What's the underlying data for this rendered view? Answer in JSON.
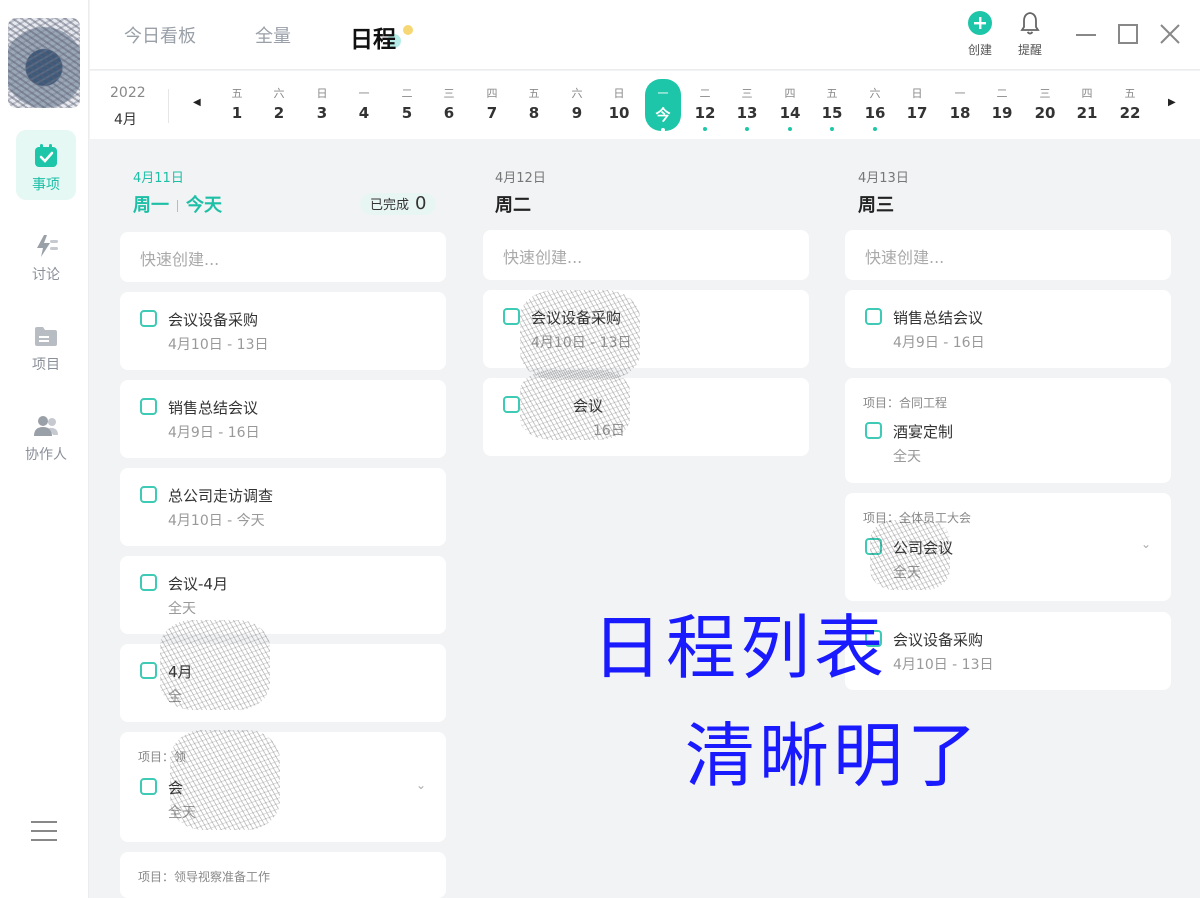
{
  "sidebar": {
    "items": [
      {
        "label": "事项",
        "icon": "calendar-check-icon"
      },
      {
        "label": "讨论",
        "icon": "lightning-icon"
      },
      {
        "label": "项目",
        "icon": "folder-icon"
      },
      {
        "label": "协作人",
        "icon": "people-icon"
      }
    ],
    "menu_icon": "hamburger-menu-icon"
  },
  "header": {
    "tabs": [
      {
        "label": "今日看板"
      },
      {
        "label": "全量"
      },
      {
        "label": "日程"
      }
    ],
    "actions": [
      {
        "label": "创建",
        "icon": "plus-circle-icon"
      },
      {
        "label": "提醒",
        "icon": "bell-icon"
      }
    ]
  },
  "datestrip": {
    "year": "2022",
    "month": "4月",
    "days": [
      {
        "wd": "五",
        "dn": "1"
      },
      {
        "wd": "六",
        "dn": "2"
      },
      {
        "wd": "日",
        "dn": "3"
      },
      {
        "wd": "一",
        "dn": "4"
      },
      {
        "wd": "二",
        "dn": "5"
      },
      {
        "wd": "三",
        "dn": "6"
      },
      {
        "wd": "四",
        "dn": "7"
      },
      {
        "wd": "五",
        "dn": "8"
      },
      {
        "wd": "六",
        "dn": "9"
      },
      {
        "wd": "日",
        "dn": "10"
      },
      {
        "wd": "一",
        "dn": "今"
      },
      {
        "wd": "二",
        "dn": "12"
      },
      {
        "wd": "三",
        "dn": "13"
      },
      {
        "wd": "四",
        "dn": "14"
      },
      {
        "wd": "五",
        "dn": "15"
      },
      {
        "wd": "六",
        "dn": "16"
      },
      {
        "wd": "日",
        "dn": "17"
      },
      {
        "wd": "一",
        "dn": "18"
      },
      {
        "wd": "二",
        "dn": "19"
      },
      {
        "wd": "三",
        "dn": "20"
      },
      {
        "wd": "四",
        "dn": "21"
      },
      {
        "wd": "五",
        "dn": "22"
      }
    ]
  },
  "columns": [
    {
      "date": "4月11日",
      "weekday": "周一",
      "today": "今天",
      "done_label": "已完成",
      "done_count": "0",
      "quick_placeholder": "快速创建...",
      "cards": [
        {
          "title": "会议设备采购",
          "sub": "4月10日 - 13日"
        },
        {
          "title": "销售总结会议",
          "sub": "4月9日 - 16日"
        },
        {
          "title": "总公司走访调查",
          "sub": "4月10日 - 今天"
        },
        {
          "title": "会议-4月",
          "sub": "全天"
        },
        {
          "title": "4月",
          "sub": "全"
        },
        {
          "project": "项目：领",
          "title": "会",
          "sub": "全天"
        },
        {
          "project": "项目：领导视察准备工作"
        }
      ]
    },
    {
      "date": "4月12日",
      "weekday": "周二",
      "quick_placeholder": "快速创建...",
      "cards": [
        {
          "title": "会议设备采购",
          "sub": "4月10日 - 13日"
        },
        {
          "title": "会议",
          "sub": "16日"
        }
      ]
    },
    {
      "date": "4月13日",
      "weekday": "周三",
      "quick_placeholder": "快速创建...",
      "cards": [
        {
          "title": "销售总结会议",
          "sub": "4月9日 - 16日"
        },
        {
          "project": "项目：合同工程",
          "title": "酒宴定制",
          "sub": "全天"
        },
        {
          "project": "项目：全体员工大会",
          "title": "公司会议",
          "sub": "全天"
        },
        {
          "title": "会议设备采购",
          "sub": "4月10日 - 13日"
        }
      ]
    }
  ],
  "overlay": {
    "line1": "日程列表",
    "line2": "清晰明了"
  },
  "colors": {
    "accent": "#1dc6a8",
    "overlay_text": "#1a1aff"
  }
}
